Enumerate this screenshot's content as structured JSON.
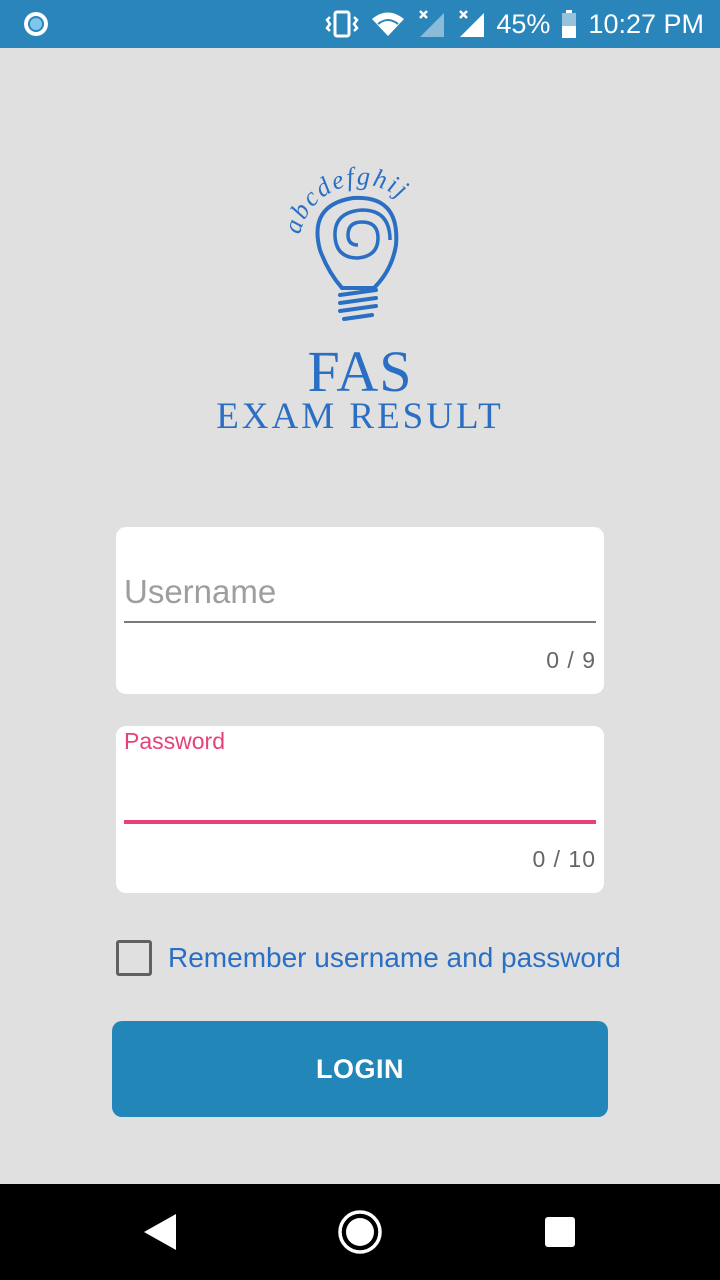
{
  "status_bar": {
    "battery": "45%",
    "time": "10:27 PM",
    "icons": [
      "notification-dot-icon",
      "vibrate-icon",
      "wifi-icon",
      "signal-no-data-icon",
      "signal-no-data-icon",
      "battery-icon"
    ]
  },
  "logo": {
    "bulb_letters": "abcdefghij",
    "title": "FAS",
    "subtitle": "EXAM RESULT",
    "color": "#2a6fc4"
  },
  "username_field": {
    "placeholder": "Username",
    "counter": "0 / 9"
  },
  "password_field": {
    "label": "Password",
    "counter": "0 / 10",
    "accent": "#e8407a"
  },
  "remember": {
    "label": "Remember username and password",
    "checked": false
  },
  "login_button": {
    "label": "LOGIN",
    "color": "#2386b9"
  },
  "nav_bar": {
    "icons": [
      "back-icon",
      "home-icon",
      "recent-apps-icon"
    ]
  }
}
